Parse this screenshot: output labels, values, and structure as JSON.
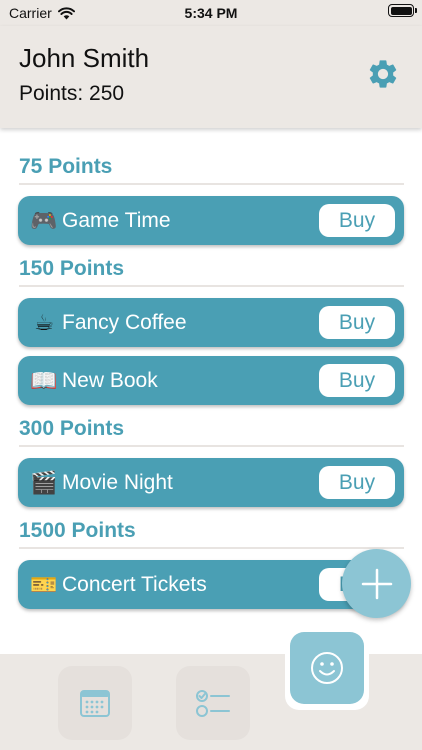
{
  "status_bar": {
    "carrier": "Carrier",
    "time": "5:34 PM"
  },
  "header": {
    "user_name": "John Smith",
    "points_label": "Points: 250"
  },
  "colors": {
    "accent": "#4a9fb4",
    "accent_light": "#8cc5d4",
    "header_bg": "#ece8e4"
  },
  "sections": [
    {
      "title": "75 Points"
    },
    {
      "title": "150 Points"
    },
    {
      "title": "300 Points"
    },
    {
      "title": "1500 Points"
    }
  ],
  "rewards": [
    {
      "emoji": "🎮",
      "name": "Game Time",
      "buy_label": "Buy"
    },
    {
      "emoji": "☕",
      "name": "Fancy Coffee",
      "buy_label": "Buy"
    },
    {
      "emoji": "📖",
      "name": "New Book",
      "buy_label": "Buy"
    },
    {
      "emoji": "🎬",
      "name": "Movie Night",
      "buy_label": "Buy"
    },
    {
      "emoji": "🎫",
      "name": "Concert Tickets",
      "buy_label": "Buy"
    }
  ],
  "tabs": [
    {
      "icon": "calendar-icon"
    },
    {
      "icon": "checklist-icon"
    },
    {
      "icon": "smiley-icon",
      "selected": true
    }
  ],
  "fab_icon": "plus-icon"
}
